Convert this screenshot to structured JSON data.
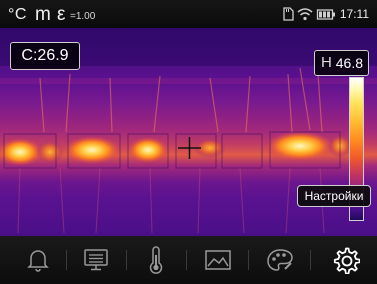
{
  "status_bar": {
    "temp_unit": "°C",
    "measure_mode": "m",
    "emissivity_symbol": "ε",
    "emissivity_value": "=1.00",
    "icons": [
      "sd-card-icon",
      "wifi-icon",
      "battery-icon"
    ],
    "time": "17:11"
  },
  "thermal": {
    "center_temp": "C:26.9",
    "max_label": "H",
    "max_temp": "46.8",
    "palette": "ironbow"
  },
  "tooltip": {
    "settings": "Настройки"
  },
  "toolbar": {
    "items": [
      {
        "name": "alarm",
        "icon": "bell-icon"
      },
      {
        "name": "display",
        "icon": "monitor-icon"
      },
      {
        "name": "thermometer",
        "icon": "thermometer-icon"
      },
      {
        "name": "gallery",
        "icon": "image-icon"
      },
      {
        "name": "palette",
        "icon": "palette-icon"
      },
      {
        "name": "settings",
        "icon": "gear-icon",
        "active": true
      }
    ]
  },
  "colors": {
    "accent": "#ffffff",
    "toolbar_bg": "#111111"
  }
}
